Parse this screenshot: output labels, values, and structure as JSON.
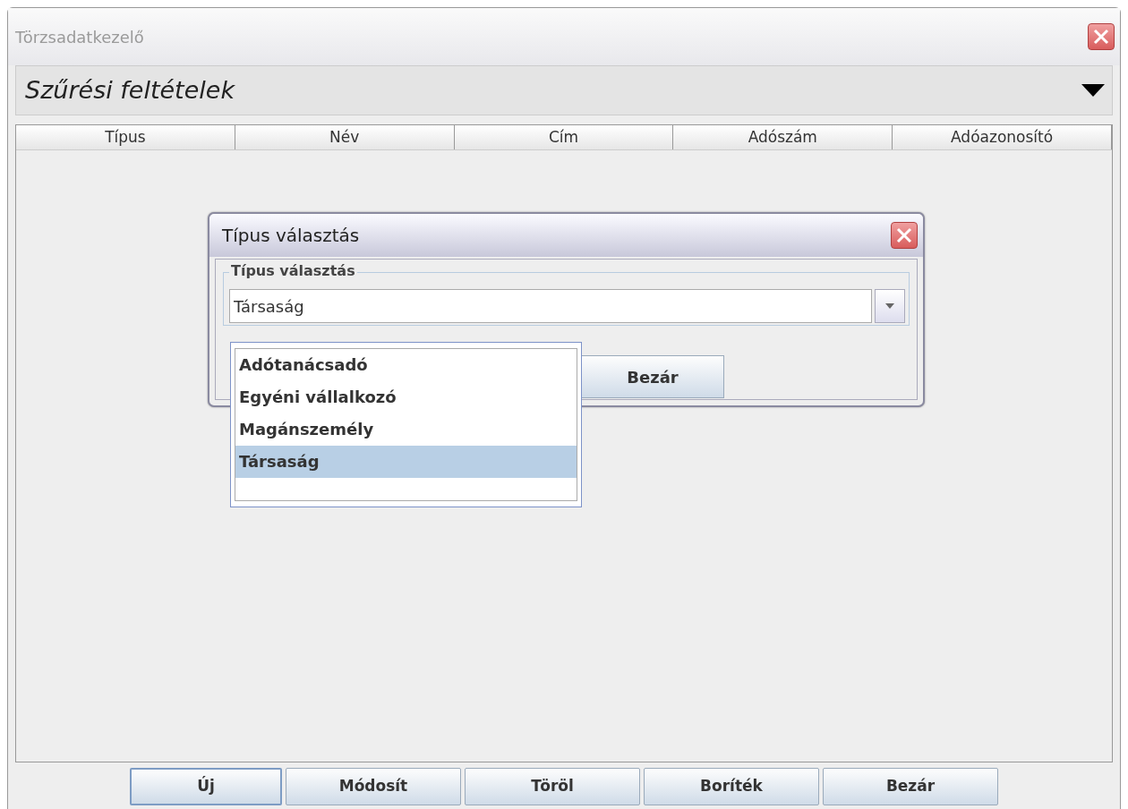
{
  "window": {
    "title": "Törzsadatkezelő"
  },
  "filter_panel": {
    "title": "Szűrési feltételek"
  },
  "table": {
    "columns": [
      "Típus",
      "Név",
      "Cím",
      "Adószám",
      "Adóazonosító"
    ]
  },
  "dialog": {
    "title": "Típus választás",
    "group_label": "Típus választás",
    "combo": {
      "value": "Társaság",
      "open": true,
      "options": [
        {
          "label": "Adótanácsadó",
          "selected": false
        },
        {
          "label": "Egyéni vállalkozó",
          "selected": false
        },
        {
          "label": "Magánszemély",
          "selected": false
        },
        {
          "label": "Társaság",
          "selected": true
        }
      ]
    },
    "button": "Bezár"
  },
  "buttons": [
    {
      "label": "Új",
      "focused": true
    },
    {
      "label": "Módosít",
      "focused": false
    },
    {
      "label": "Töröl",
      "focused": false
    },
    {
      "label": "Boríték",
      "focused": false
    },
    {
      "label": "Bezár",
      "focused": false
    }
  ]
}
